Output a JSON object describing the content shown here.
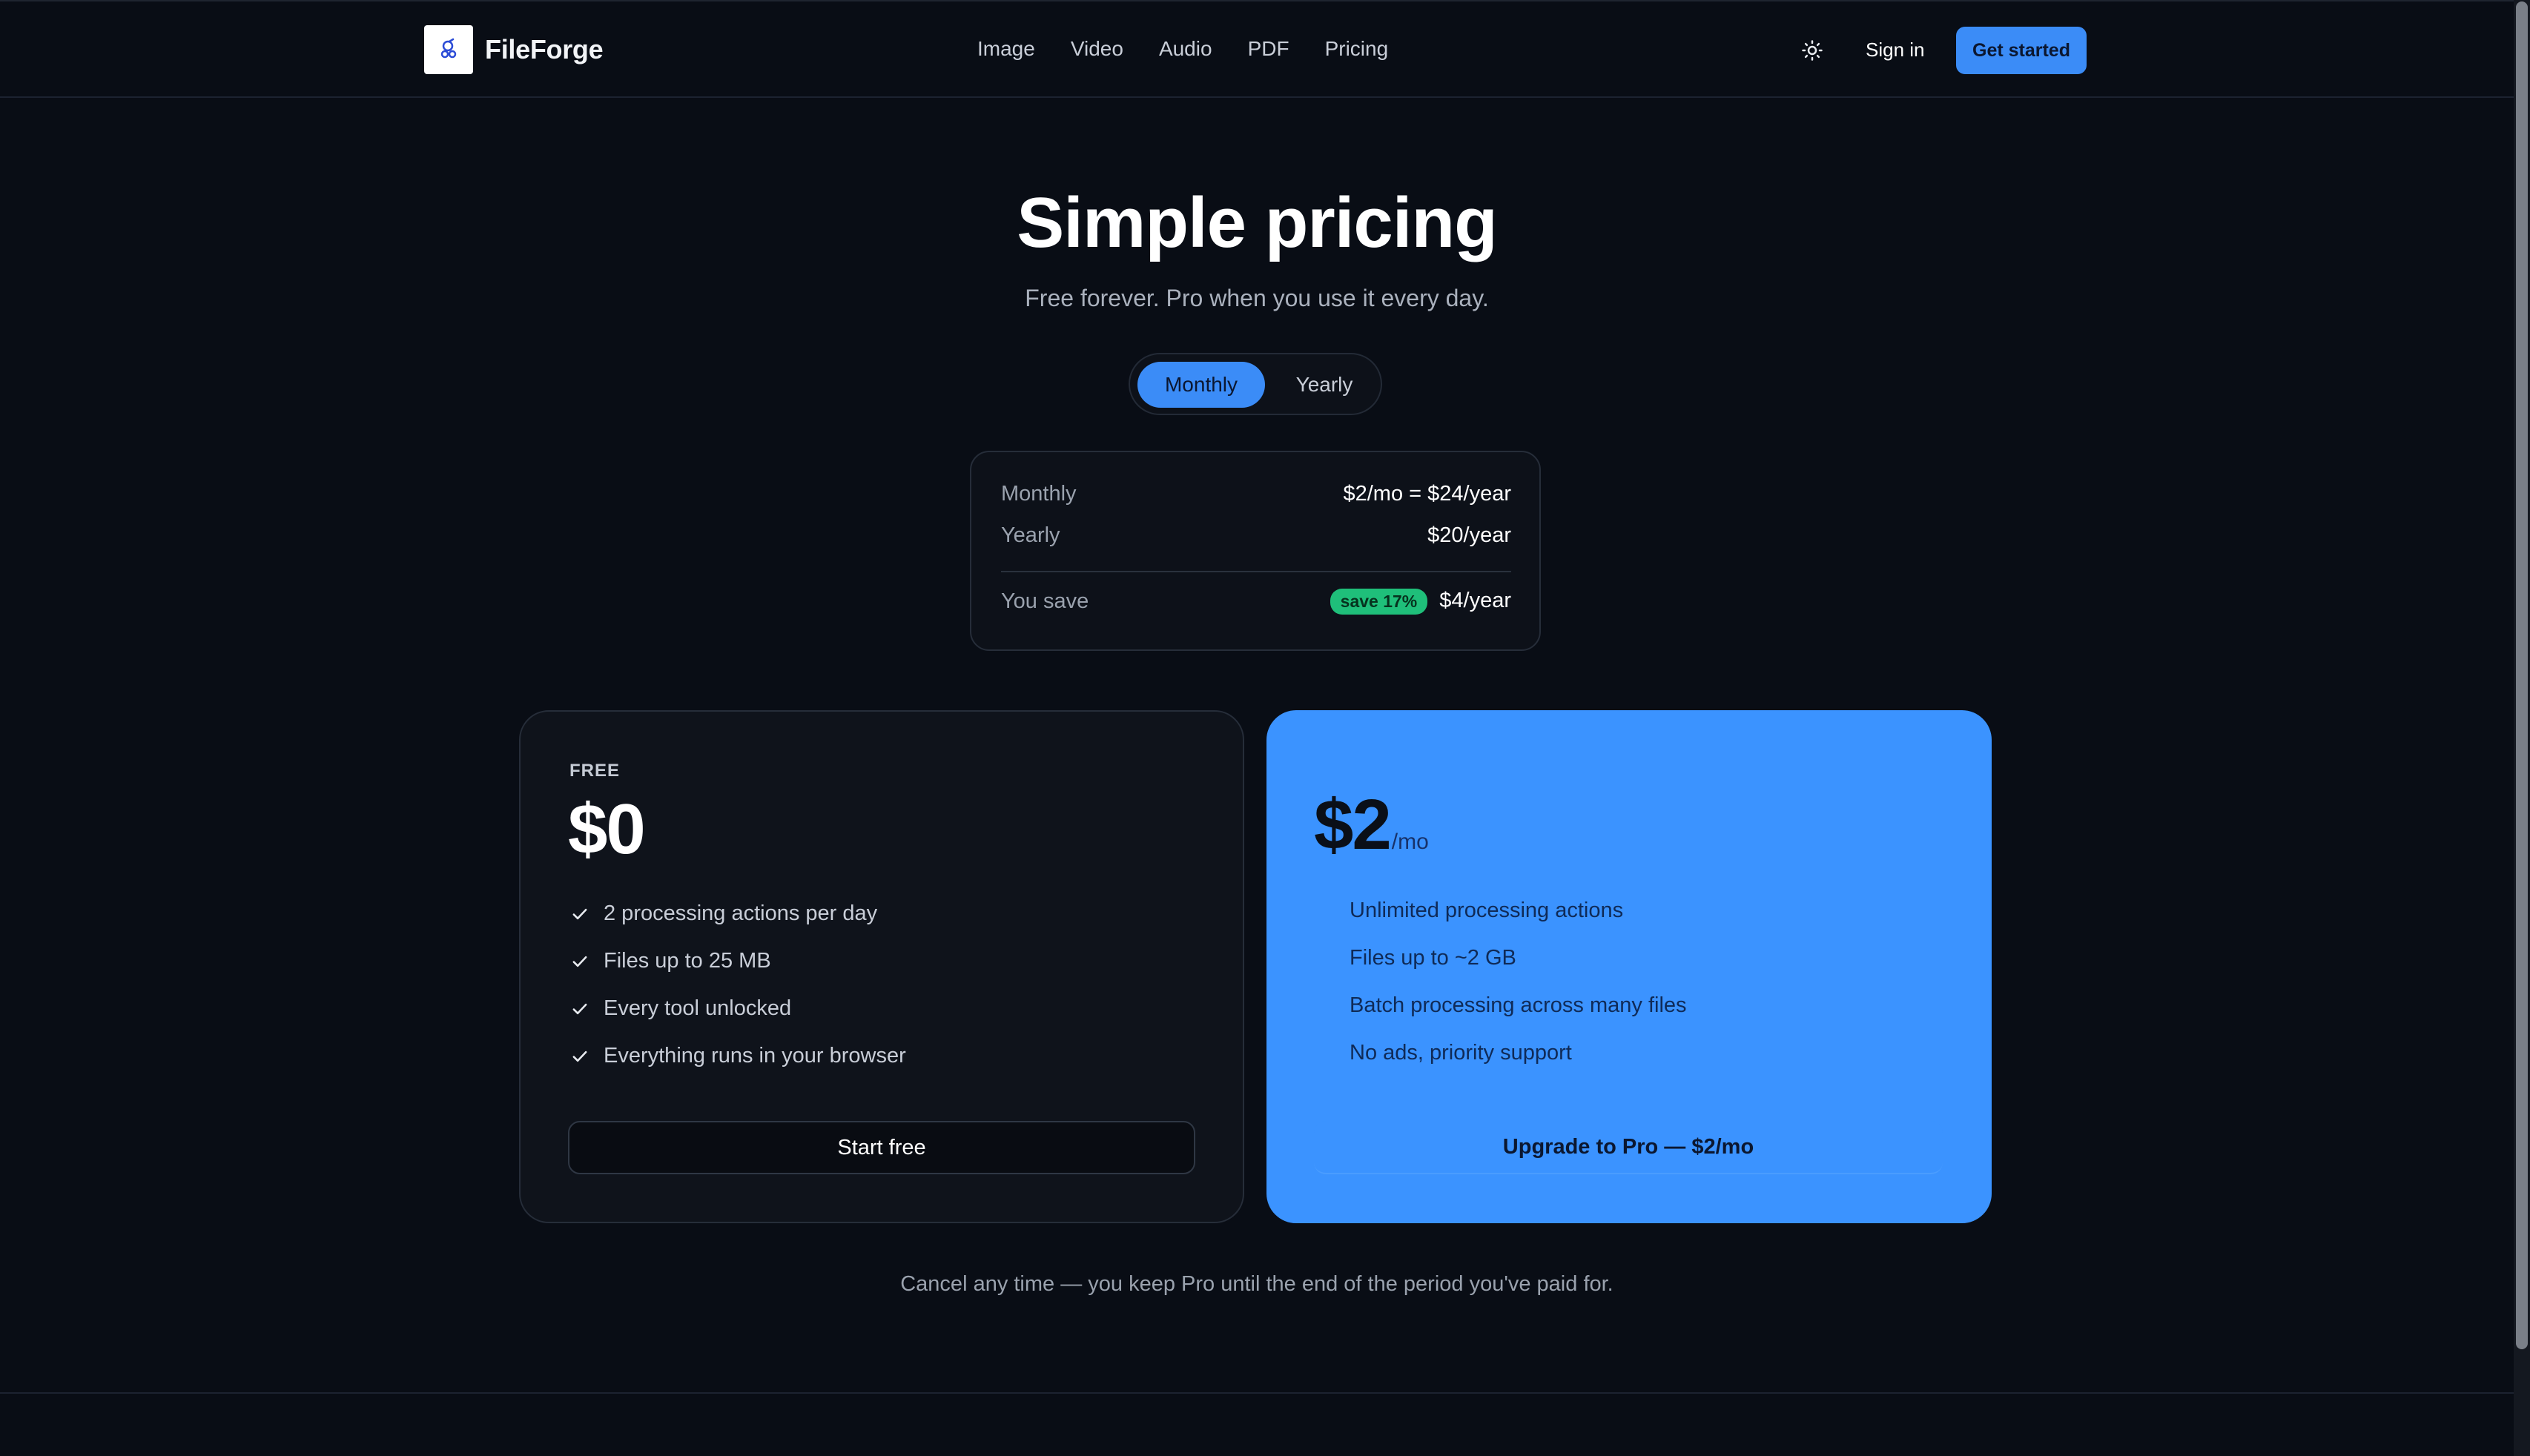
{
  "header": {
    "brand": "FileForge",
    "nav": [
      "Image",
      "Video",
      "Audio",
      "PDF",
      "Pricing"
    ],
    "sign_in": "Sign in",
    "get_started": "Get started",
    "theme_icon": "sun-icon"
  },
  "hero": {
    "title": "Simple pricing",
    "subtitle": "Free forever. Pro when you use it every day."
  },
  "billing_toggle": {
    "options": [
      "Monthly",
      "Yearly"
    ],
    "selected": "Monthly"
  },
  "comparison": {
    "rows": [
      {
        "label": "Monthly",
        "value": "$2/mo = $24/year"
      },
      {
        "label": "Yearly",
        "value": "$20/year"
      }
    ],
    "savings_label": "You save",
    "savings_badge": "save 17%",
    "savings_value": "$4/year"
  },
  "plans": {
    "free": {
      "tier": "FREE",
      "price": "$0",
      "features": [
        "2 processing actions per day",
        "Files up to 25 MB",
        "Every tool unlocked",
        "Everything runs in your browser"
      ],
      "cta": "Start free"
    },
    "pro": {
      "price": "$2",
      "unit": "/mo",
      "features": [
        "Unlimited processing actions",
        "Files up to ~2 GB",
        "Batch processing across many files",
        "No ads, priority support"
      ],
      "cta": "Upgrade to Pro — $2/mo"
    }
  },
  "footnote": "Cancel any time — you keep Pro until the end of the period you've paid for.",
  "colors": {
    "background": "#090d15",
    "accent": "#3b8cf7",
    "pro_card": "#3b93ff",
    "save_badge": "#1fbf7a"
  }
}
